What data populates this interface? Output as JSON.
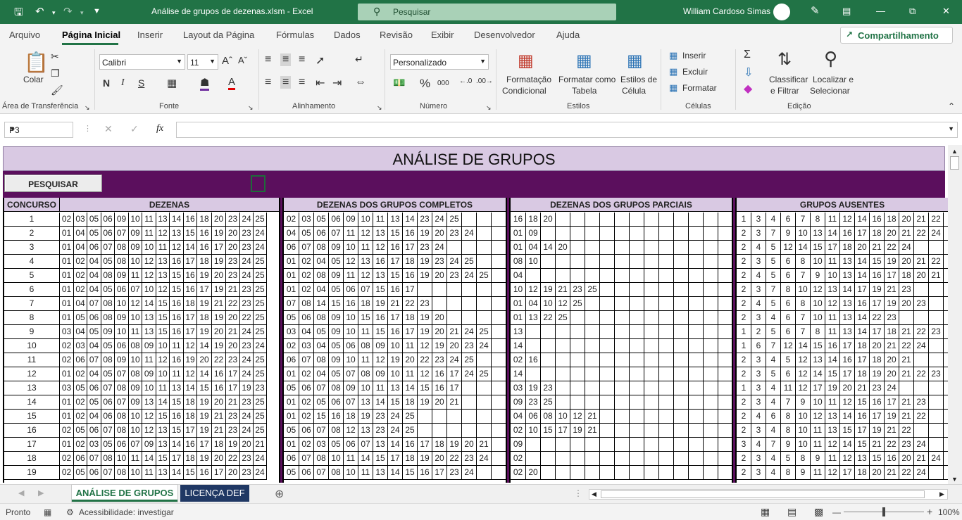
{
  "window": {
    "title": "Análise de grupos de dezenas.xlsm  -  Excel",
    "search_placeholder": "Pesquisar",
    "user": "William Cardoso Simas"
  },
  "tabs": [
    "Arquivo",
    "Página Inicial",
    "Inserir",
    "Layout da Página",
    "Fórmulas",
    "Dados",
    "Revisão",
    "Exibir",
    "Desenvolvedor",
    "Ajuda"
  ],
  "share_label": "Compartilhamento",
  "ribbon": {
    "clipboard": {
      "paste": "Colar",
      "label": "Área de Transferência"
    },
    "font": {
      "name": "Calibri",
      "size": "11",
      "label": "Fonte",
      "bold": "N",
      "italic": "I",
      "underline": "S"
    },
    "alignment": {
      "label": "Alinhamento"
    },
    "number": {
      "format": "Personalizado",
      "label": "Número",
      "percent": "%",
      "thousands": "000"
    },
    "styles": {
      "cond_format_1": "Formatação",
      "cond_format_2": "Condicional",
      "format_table_1": "Formatar como",
      "format_table_2": "Tabela",
      "cell_styles_1": "Estilos de",
      "cell_styles_2": "Célula",
      "label": "Estilos"
    },
    "cells": {
      "insert": "Inserir",
      "delete": "Excluir",
      "format": "Formatar",
      "label": "Células"
    },
    "editing": {
      "sort_1": "Classificar",
      "sort_2": "e Filtrar",
      "find_1": "Localizar e",
      "find_2": "Selecionar",
      "label": "Edição"
    }
  },
  "formula_bar": {
    "cell_ref": "P3",
    "value": "",
    "fx": "fx"
  },
  "sheet": {
    "title": "ANÁLISE DE GRUPOS",
    "search_button": "PESQUISAR",
    "headers": {
      "concurso": "CONCURSO",
      "dezenas": "DEZENAS",
      "completos": "DEZENAS DOS GRUPOS COMPLETOS",
      "parciais": "DEZENAS DOS GRUPOS PARCIAIS",
      "ausentes": "GRUPOS AUSENTES"
    },
    "rows": [
      {
        "n": "1",
        "d": [
          "02",
          "03",
          "05",
          "06",
          "09",
          "10",
          "11",
          "13",
          "14",
          "16",
          "18",
          "20",
          "23",
          "24",
          "25"
        ],
        "c": [
          "02",
          "03",
          "05",
          "06",
          "09",
          "10",
          "11",
          "13",
          "14",
          "23",
          "24",
          "25"
        ],
        "p": [
          "16",
          "18",
          "20"
        ],
        "a": [
          "1",
          "3",
          "4",
          "6",
          "7",
          "8",
          "11",
          "12",
          "14",
          "16",
          "18",
          "20",
          "21",
          "22"
        ]
      },
      {
        "n": "2",
        "d": [
          "01",
          "04",
          "05",
          "06",
          "07",
          "09",
          "11",
          "12",
          "13",
          "15",
          "16",
          "19",
          "20",
          "23",
          "24"
        ],
        "c": [
          "04",
          "05",
          "06",
          "07",
          "11",
          "12",
          "13",
          "15",
          "16",
          "19",
          "20",
          "23",
          "24"
        ],
        "p": [
          "01",
          "09"
        ],
        "a": [
          "2",
          "3",
          "7",
          "9",
          "10",
          "13",
          "14",
          "16",
          "17",
          "18",
          "20",
          "21",
          "22",
          "24"
        ]
      },
      {
        "n": "3",
        "d": [
          "01",
          "04",
          "06",
          "07",
          "08",
          "09",
          "10",
          "11",
          "12",
          "14",
          "16",
          "17",
          "20",
          "23",
          "24"
        ],
        "c": [
          "06",
          "07",
          "08",
          "09",
          "10",
          "11",
          "12",
          "16",
          "17",
          "23",
          "24"
        ],
        "p": [
          "01",
          "04",
          "14",
          "20"
        ],
        "a": [
          "2",
          "4",
          "5",
          "12",
          "14",
          "15",
          "17",
          "18",
          "20",
          "21",
          "22",
          "24"
        ]
      },
      {
        "n": "4",
        "d": [
          "01",
          "02",
          "04",
          "05",
          "08",
          "10",
          "12",
          "13",
          "16",
          "17",
          "18",
          "19",
          "23",
          "24",
          "25"
        ],
        "c": [
          "01",
          "02",
          "04",
          "05",
          "12",
          "13",
          "16",
          "17",
          "18",
          "19",
          "23",
          "24",
          "25"
        ],
        "p": [
          "08",
          "10"
        ],
        "a": [
          "2",
          "3",
          "5",
          "6",
          "8",
          "10",
          "11",
          "13",
          "14",
          "15",
          "19",
          "20",
          "21",
          "22"
        ]
      },
      {
        "n": "5",
        "d": [
          "01",
          "02",
          "04",
          "08",
          "09",
          "11",
          "12",
          "13",
          "15",
          "16",
          "19",
          "20",
          "23",
          "24",
          "25"
        ],
        "c": [
          "01",
          "02",
          "08",
          "09",
          "11",
          "12",
          "13",
          "15",
          "16",
          "19",
          "20",
          "23",
          "24",
          "25"
        ],
        "p": [
          "04"
        ],
        "a": [
          "2",
          "4",
          "5",
          "6",
          "7",
          "9",
          "10",
          "13",
          "14",
          "16",
          "17",
          "18",
          "20",
          "21"
        ]
      },
      {
        "n": "6",
        "d": [
          "01",
          "02",
          "04",
          "05",
          "06",
          "07",
          "10",
          "12",
          "15",
          "16",
          "17",
          "19",
          "21",
          "23",
          "25"
        ],
        "c": [
          "01",
          "02",
          "04",
          "05",
          "06",
          "07",
          "15",
          "16",
          "17"
        ],
        "p": [
          "10",
          "12",
          "19",
          "21",
          "23",
          "25"
        ],
        "a": [
          "2",
          "3",
          "7",
          "8",
          "10",
          "12",
          "13",
          "14",
          "17",
          "19",
          "21",
          "23"
        ]
      },
      {
        "n": "7",
        "d": [
          "01",
          "04",
          "07",
          "08",
          "10",
          "12",
          "14",
          "15",
          "16",
          "18",
          "19",
          "21",
          "22",
          "23",
          "25"
        ],
        "c": [
          "07",
          "08",
          "14",
          "15",
          "16",
          "18",
          "19",
          "21",
          "22",
          "23"
        ],
        "p": [
          "01",
          "04",
          "10",
          "12",
          "25"
        ],
        "a": [
          "2",
          "4",
          "5",
          "6",
          "8",
          "10",
          "12",
          "13",
          "16",
          "17",
          "19",
          "20",
          "23"
        ]
      },
      {
        "n": "8",
        "d": [
          "01",
          "05",
          "06",
          "08",
          "09",
          "10",
          "13",
          "15",
          "16",
          "17",
          "18",
          "19",
          "20",
          "22",
          "25"
        ],
        "c": [
          "05",
          "06",
          "08",
          "09",
          "10",
          "15",
          "16",
          "17",
          "18",
          "19",
          "20"
        ],
        "p": [
          "01",
          "13",
          "22",
          "25"
        ],
        "a": [
          "2",
          "3",
          "4",
          "6",
          "7",
          "10",
          "11",
          "13",
          "14",
          "22",
          "23"
        ]
      },
      {
        "n": "9",
        "d": [
          "03",
          "04",
          "05",
          "09",
          "10",
          "11",
          "13",
          "15",
          "16",
          "17",
          "19",
          "20",
          "21",
          "24",
          "25"
        ],
        "c": [
          "03",
          "04",
          "05",
          "09",
          "10",
          "11",
          "15",
          "16",
          "17",
          "19",
          "20",
          "21",
          "24",
          "25"
        ],
        "p": [
          "13"
        ],
        "a": [
          "1",
          "2",
          "5",
          "6",
          "7",
          "8",
          "11",
          "13",
          "14",
          "17",
          "18",
          "21",
          "22",
          "23"
        ]
      },
      {
        "n": "10",
        "d": [
          "02",
          "03",
          "04",
          "05",
          "06",
          "08",
          "09",
          "10",
          "11",
          "12",
          "14",
          "19",
          "20",
          "23",
          "24"
        ],
        "c": [
          "02",
          "03",
          "04",
          "05",
          "06",
          "08",
          "09",
          "10",
          "11",
          "12",
          "19",
          "20",
          "23",
          "24"
        ],
        "p": [
          "14"
        ],
        "a": [
          "1",
          "6",
          "7",
          "12",
          "14",
          "15",
          "16",
          "17",
          "18",
          "20",
          "21",
          "22",
          "24"
        ]
      },
      {
        "n": "11",
        "d": [
          "02",
          "06",
          "07",
          "08",
          "09",
          "10",
          "11",
          "12",
          "16",
          "19",
          "20",
          "22",
          "23",
          "24",
          "25"
        ],
        "c": [
          "06",
          "07",
          "08",
          "09",
          "10",
          "11",
          "12",
          "19",
          "20",
          "22",
          "23",
          "24",
          "25"
        ],
        "p": [
          "02",
          "16"
        ],
        "a": [
          "2",
          "3",
          "4",
          "5",
          "12",
          "13",
          "14",
          "16",
          "17",
          "18",
          "20",
          "21"
        ]
      },
      {
        "n": "12",
        "d": [
          "01",
          "02",
          "04",
          "05",
          "07",
          "08",
          "09",
          "10",
          "11",
          "12",
          "14",
          "16",
          "17",
          "24",
          "25"
        ],
        "c": [
          "01",
          "02",
          "04",
          "05",
          "07",
          "08",
          "09",
          "10",
          "11",
          "12",
          "16",
          "17",
          "24",
          "25"
        ],
        "p": [
          "14"
        ],
        "a": [
          "2",
          "3",
          "5",
          "6",
          "12",
          "14",
          "15",
          "17",
          "18",
          "19",
          "20",
          "21",
          "22",
          "23"
        ]
      },
      {
        "n": "13",
        "d": [
          "03",
          "05",
          "06",
          "07",
          "08",
          "09",
          "10",
          "11",
          "13",
          "14",
          "15",
          "16",
          "17",
          "19",
          "23"
        ],
        "c": [
          "05",
          "06",
          "07",
          "08",
          "09",
          "10",
          "11",
          "13",
          "14",
          "15",
          "16",
          "17"
        ],
        "p": [
          "03",
          "19",
          "23"
        ],
        "a": [
          "1",
          "3",
          "4",
          "11",
          "12",
          "17",
          "19",
          "20",
          "21",
          "23",
          "24"
        ]
      },
      {
        "n": "14",
        "d": [
          "01",
          "02",
          "05",
          "06",
          "07",
          "09",
          "13",
          "14",
          "15",
          "18",
          "19",
          "20",
          "21",
          "23",
          "25"
        ],
        "c": [
          "01",
          "02",
          "05",
          "06",
          "07",
          "13",
          "14",
          "15",
          "18",
          "19",
          "20",
          "21"
        ],
        "p": [
          "09",
          "23",
          "25"
        ],
        "a": [
          "2",
          "3",
          "4",
          "7",
          "9",
          "10",
          "11",
          "12",
          "15",
          "16",
          "17",
          "21",
          "23"
        ]
      },
      {
        "n": "15",
        "d": [
          "01",
          "02",
          "04",
          "06",
          "08",
          "10",
          "12",
          "15",
          "16",
          "18",
          "19",
          "21",
          "23",
          "24",
          "25"
        ],
        "c": [
          "01",
          "02",
          "15",
          "16",
          "18",
          "19",
          "23",
          "24",
          "25"
        ],
        "p": [
          "04",
          "06",
          "08",
          "10",
          "12",
          "21"
        ],
        "a": [
          "2",
          "4",
          "6",
          "8",
          "10",
          "12",
          "13",
          "14",
          "16",
          "17",
          "19",
          "21",
          "22"
        ]
      },
      {
        "n": "16",
        "d": [
          "02",
          "05",
          "06",
          "07",
          "08",
          "10",
          "12",
          "13",
          "15",
          "17",
          "19",
          "21",
          "23",
          "24",
          "25"
        ],
        "c": [
          "05",
          "06",
          "07",
          "08",
          "12",
          "13",
          "23",
          "24",
          "25"
        ],
        "p": [
          "02",
          "10",
          "15",
          "17",
          "19",
          "21"
        ],
        "a": [
          "2",
          "3",
          "4",
          "8",
          "10",
          "11",
          "13",
          "15",
          "17",
          "19",
          "21",
          "22"
        ]
      },
      {
        "n": "17",
        "d": [
          "01",
          "02",
          "03",
          "05",
          "06",
          "07",
          "09",
          "13",
          "14",
          "16",
          "17",
          "18",
          "19",
          "20",
          "21"
        ],
        "c": [
          "01",
          "02",
          "03",
          "05",
          "06",
          "07",
          "13",
          "14",
          "16",
          "17",
          "18",
          "19",
          "20",
          "21"
        ],
        "p": [
          "09"
        ],
        "a": [
          "3",
          "4",
          "7",
          "9",
          "10",
          "11",
          "12",
          "14",
          "15",
          "21",
          "22",
          "23",
          "24"
        ]
      },
      {
        "n": "18",
        "d": [
          "02",
          "06",
          "07",
          "08",
          "10",
          "11",
          "14",
          "15",
          "17",
          "18",
          "19",
          "20",
          "22",
          "23",
          "24"
        ],
        "c": [
          "06",
          "07",
          "08",
          "10",
          "11",
          "14",
          "15",
          "17",
          "18",
          "19",
          "20",
          "22",
          "23",
          "24"
        ],
        "p": [
          "02"
        ],
        "a": [
          "2",
          "3",
          "4",
          "5",
          "8",
          "9",
          "11",
          "12",
          "13",
          "15",
          "16",
          "20",
          "21",
          "24"
        ]
      },
      {
        "n": "19",
        "d": [
          "02",
          "05",
          "06",
          "07",
          "08",
          "10",
          "11",
          "13",
          "14",
          "15",
          "16",
          "17",
          "20",
          "23",
          "24"
        ],
        "c": [
          "05",
          "06",
          "07",
          "08",
          "10",
          "11",
          "13",
          "14",
          "15",
          "16",
          "17",
          "23",
          "24"
        ],
        "p": [
          "02",
          "20"
        ],
        "a": [
          "2",
          "3",
          "4",
          "8",
          "9",
          "11",
          "12",
          "17",
          "18",
          "20",
          "21",
          "22",
          "24"
        ]
      }
    ]
  },
  "sheet_tabs": [
    "ANÁLISE DE GRUPOS",
    "LICENÇA DEF"
  ],
  "status": {
    "ready": "Pronto",
    "accessibility": "Acessibilidade: investigar",
    "zoom": "100%"
  }
}
